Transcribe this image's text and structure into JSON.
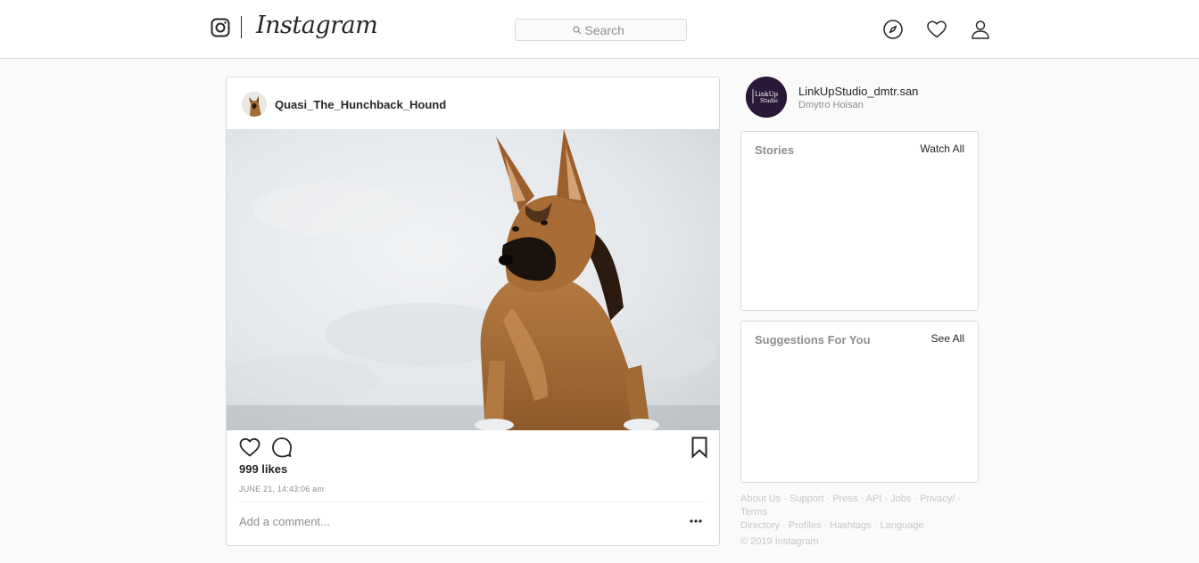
{
  "header": {
    "logo_text": "Instagram",
    "search_placeholder": "Search"
  },
  "post": {
    "username": "Quasi_The_Hunchback_Hound",
    "likes": "999 likes",
    "timestamp": "JUNE 21, 14:43:06 am",
    "comment_placeholder": "Add a comment..."
  },
  "profile": {
    "username": "LinkUpStudio_dmtr.san",
    "fullname": "Dmytro Hoisan",
    "avatar_text": "LinkUp Studio"
  },
  "stories": {
    "title": "Stories",
    "link": "Watch All"
  },
  "suggestions": {
    "title": "Suggestions For You",
    "link": "See All"
  },
  "footer": {
    "links": [
      "About Us",
      "Support",
      "Press",
      "API",
      "Jobs",
      "Privacy/",
      "Terms",
      "Directory",
      "Profiles",
      "Hashtags",
      "Language"
    ],
    "copyright": "© 2019 Instagram"
  },
  "colors": {
    "border": "#dbdbdb",
    "text": "#262626",
    "muted": "#8e8e8e",
    "background": "#fafafa"
  }
}
